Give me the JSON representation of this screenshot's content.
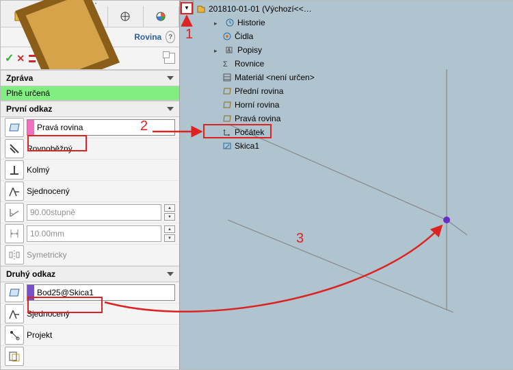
{
  "feature": {
    "name": "Rovina"
  },
  "sections": {
    "zprava": {
      "title": "Zpráva",
      "status": "Plně určená"
    },
    "prvni_odkaz": {
      "title": "První odkaz",
      "selection": "Pravá rovina",
      "opts": {
        "rovnobezny": "Rovnoběžný",
        "kolmy": "Kolmý",
        "sjednoceny": "Sjednocený",
        "uhel": "90.00stupně",
        "vzdalenost": "10.00mm",
        "symetricky": "Symetricky"
      }
    },
    "druhy_odkaz": {
      "title": "Druhý odkaz",
      "selection": "Bod25@Skica1",
      "opts": {
        "sjednoceny": "Sjednocený",
        "projekt": "Projekt"
      }
    }
  },
  "tree": {
    "root": "201810-01-01 (Výchozí<<…",
    "items": {
      "historie": "Historie",
      "cidla": "Čidla",
      "popisy": "Popisy",
      "rovnice": "Rovnice",
      "material": "Materiál <není určen>",
      "predni": "Přední rovina",
      "horni": "Horní rovina",
      "prava": "Pravá rovina",
      "pocatek": "Počátek",
      "skica": "Skica1"
    }
  },
  "callouts": {
    "c1": "1",
    "c2": "2",
    "c3": "3"
  }
}
